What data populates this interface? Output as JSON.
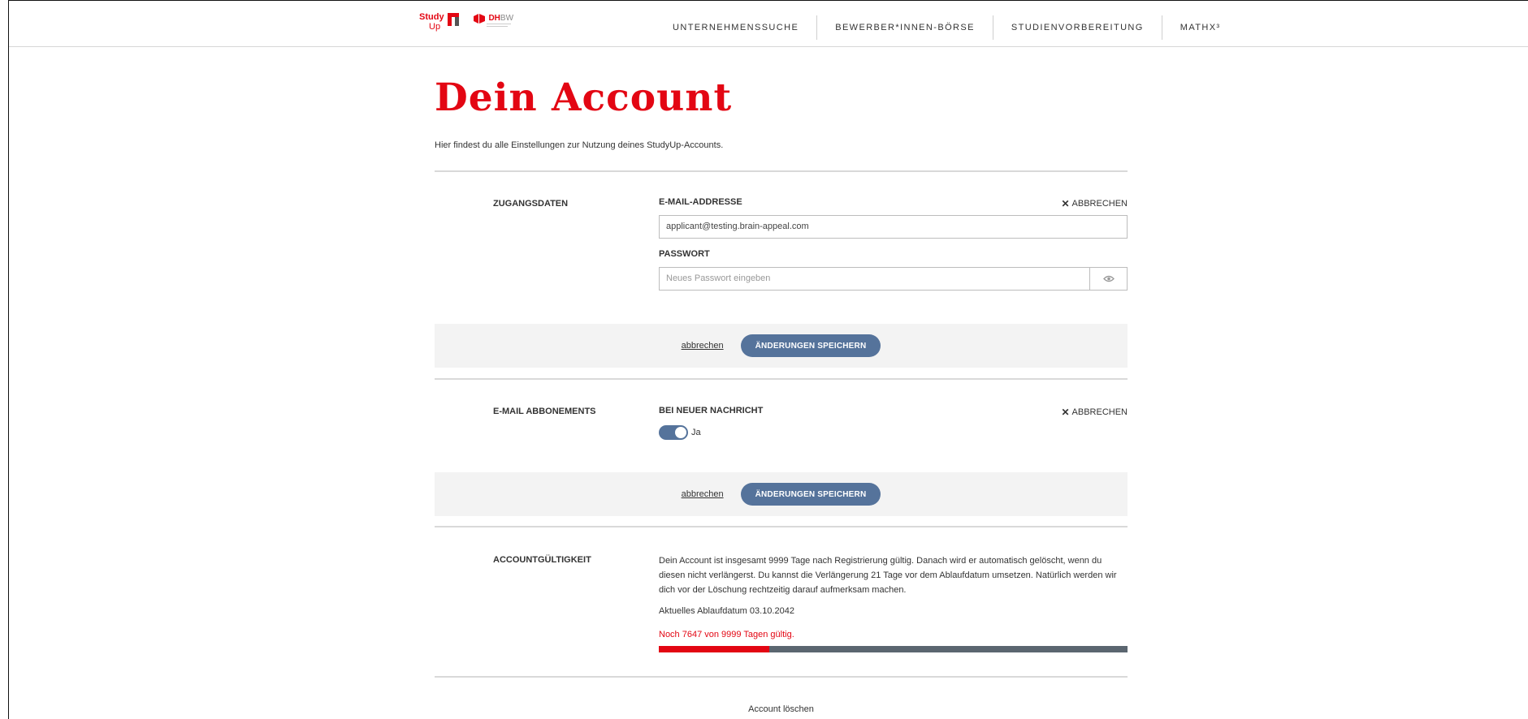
{
  "header": {
    "logo_study": "Study",
    "logo_up": "Up",
    "logo_dhbw_dh": "DH",
    "logo_dhbw_bw": "BW",
    "nav": [
      {
        "label": "UNTERNEHMENSSUCHE"
      },
      {
        "label": "BEWERBER*INNEN-BÖRSE"
      },
      {
        "label": "STUDIENVORBEREITUNG"
      },
      {
        "label": "MATHX³"
      }
    ]
  },
  "page": {
    "title": "Dein Account",
    "intro": "Hier findest du alle Einstellungen zur Nutzung deines StudyUp-Accounts."
  },
  "access": {
    "section_label": "ZUGANGSDATEN",
    "email_label": "E-MAIL-ADDRESSE",
    "email_value": "applicant@testing.brain-appeal.com",
    "cancel_label": "ABBRECHEN",
    "password_label": "PASSWORT",
    "password_placeholder": "Neues Passwort eingeben",
    "eye_icon": "eye-icon",
    "abort_link": "abbrechen",
    "save_button": "ÄNDERUNGEN SPEICHERN"
  },
  "subscriptions": {
    "section_label": "E-MAIL ABBONEMENTS",
    "field_label": "BEI NEUER NACHRICHT",
    "cancel_label": "ABBRECHEN",
    "toggle_on": true,
    "toggle_label": "Ja",
    "abort_link": "abbrechen",
    "save_button": "ÄNDERUNGEN SPEICHERN"
  },
  "validity": {
    "section_label": "ACCOUNTGÜLTIGKEIT",
    "description": "Dein Account ist insgesamt 9999 Tage nach Registrierung gültig. Danach wird er automatisch gelöscht, wenn du diesen nicht verlängerst. Du kannst die Verlängerung 21 Tage vor dem Ablaufdatum umsetzen. Natürlich werden wir dich vor der Löschung rechtzeitig darauf aufmerksam machen.",
    "expiry_text": "Aktuelles Ablaufdatum 03.10.2042",
    "remaining_text": "Noch 7647 von 9999 Tagen gültig.",
    "remaining_days": 7647,
    "total_days": 9999,
    "progress_color": "#e30613",
    "track_color": "#5b6670"
  },
  "footer": {
    "delete_link": "Account löschen"
  },
  "colors": {
    "accent_red": "#e30613",
    "button_blue": "#55739b"
  }
}
